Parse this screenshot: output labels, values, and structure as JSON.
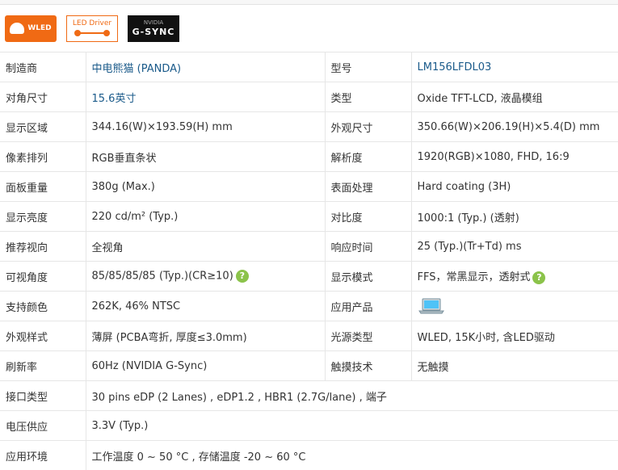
{
  "badges": {
    "wled": "WLED",
    "led_driver": "LED Driver",
    "nvidia": "NVIDIA",
    "gsync": "G-SYNC"
  },
  "help_glyph": "?",
  "rows": [
    [
      "制造商",
      "中电熊猫 (PANDA)",
      "型号",
      "LM156LFDL03"
    ],
    [
      "对角尺寸",
      "15.6英寸",
      "类型",
      "Oxide TFT-LCD, 液晶模组"
    ],
    [
      "显示区域",
      "344.16(W)×193.59(H) mm",
      "外观尺寸",
      "350.66(W)×206.19(H)×5.4(D) mm"
    ],
    [
      "像素排列",
      "RGB垂直条状",
      "解析度",
      "1920(RGB)×1080, FHD, 16:9"
    ],
    [
      "面板重量",
      "380g (Max.)",
      "表面处理",
      "Hard coating (3H)"
    ],
    [
      "显示亮度",
      "220 cd/m² (Typ.)",
      "对比度",
      "1000:1 (Typ.) (透射)"
    ],
    [
      "推荐视向",
      "全视角",
      "响应时间",
      "25 (Typ.)(Tr+Td) ms"
    ],
    [
      "可视角度",
      "85/85/85/85 (Typ.)(CR≥10)",
      "显示模式",
      "FFS，常黑显示，透射式"
    ],
    [
      "支持颜色",
      "262K, 46% NTSC",
      "应用产品",
      ""
    ],
    [
      "外观样式",
      "薄屏 (PCBA弯折, 厚度≤3.0mm)",
      "光源类型",
      "WLED, 15K小时, 含LED驱动"
    ],
    [
      "刷新率",
      "60Hz  (NVIDIA G-Sync)",
      "触摸技术",
      "无触摸"
    ]
  ],
  "wide_rows": [
    [
      "接口类型",
      "30 pins eDP (2 Lanes) , eDP1.2 , HBR1 (2.7G/lane) , 端子"
    ],
    [
      "电压供应",
      "3.3V (Typ.)"
    ],
    [
      "应用环境",
      "工作温度 0 ~ 50 °C , 存储温度 -20 ~ 60 °C"
    ]
  ],
  "application_icon": "laptop-icon"
}
